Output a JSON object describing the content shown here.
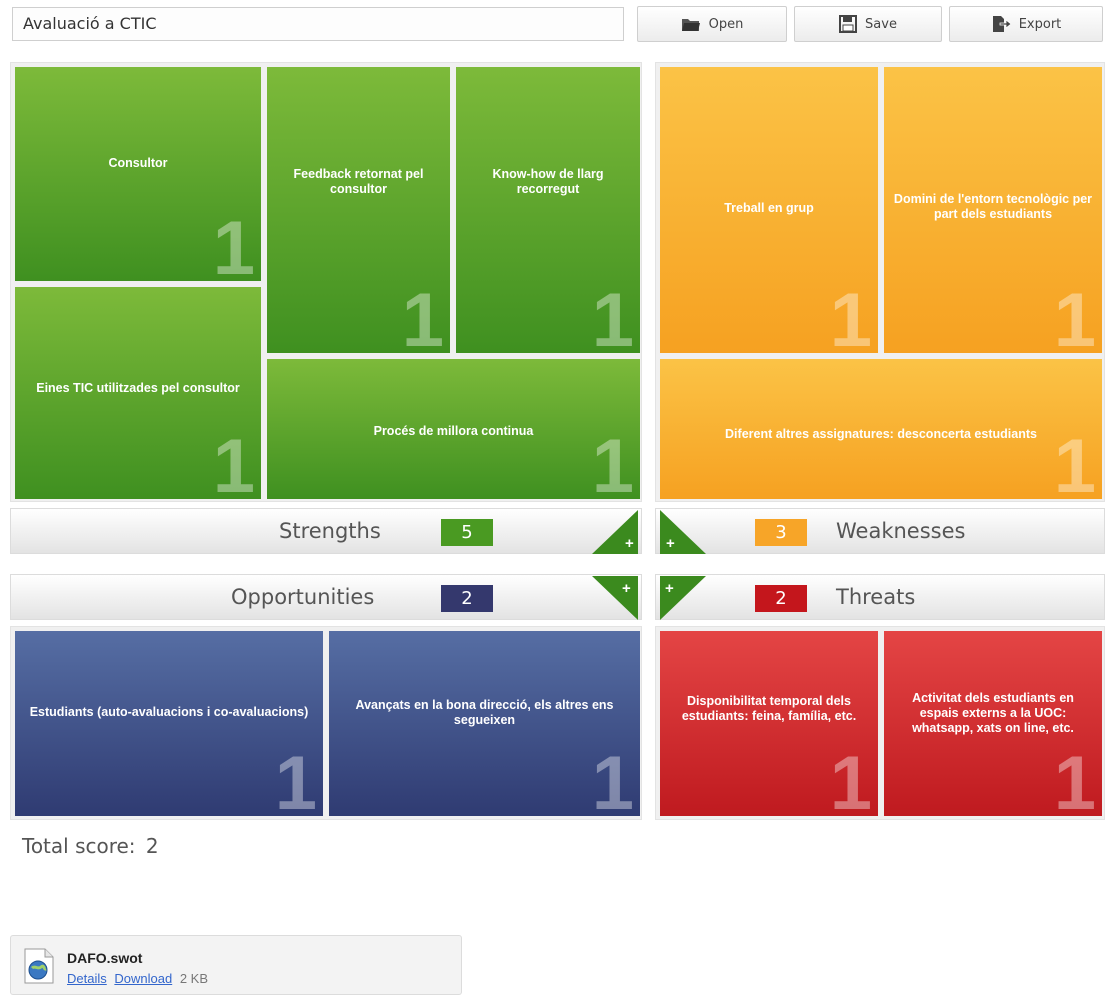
{
  "toolbar": {
    "title": "Avaluació a CTIC",
    "open_label": "Open",
    "save_label": "Save",
    "export_label": "Export"
  },
  "strengths": {
    "name": "Strengths",
    "count": "5",
    "color": "#4a9a22",
    "add_label": "+",
    "items": [
      {
        "label": "Consultor",
        "score": "1"
      },
      {
        "label": "Feedback retornat pel consultor",
        "score": "1"
      },
      {
        "label": "Know-how de llarg recorregut",
        "score": "1"
      },
      {
        "label": "Eines  TIC utilitzades pel consultor",
        "score": "1"
      },
      {
        "label": "Procés de millora continua",
        "score": "1"
      }
    ]
  },
  "weaknesses": {
    "name": "Weaknesses",
    "count": "3",
    "color": "#f7a528",
    "add_label": "+",
    "items": [
      {
        "label": "Treball en grup",
        "score": "1"
      },
      {
        "label": "Domini de l'entorn tecnològic per part dels estudiants",
        "score": "1"
      },
      {
        "label": "Diferent altres assignatures: desconcerta estudiants",
        "score": "1"
      }
    ]
  },
  "opportunities": {
    "name": "Opportunities",
    "count": "2",
    "color": "#34386d",
    "add_label": "+",
    "items": [
      {
        "label": "Estudiants  (auto-avaluacions i co-avaluacions)",
        "score": "1"
      },
      {
        "label": "Avançats en la bona direcció, els altres ens segueixen",
        "score": "1"
      }
    ]
  },
  "threats": {
    "name": "Threats",
    "count": "2",
    "color": "#c4161c",
    "add_label": "+",
    "items": [
      {
        "label": "Disponibilitat temporal dels estudiants: feina, família, etc.",
        "score": "1"
      },
      {
        "label": "Activitat dels estudiants en espais externs a la UOC: whatsapp, xats on line, etc.",
        "score": "1"
      }
    ]
  },
  "total": {
    "label": "Total score:",
    "value": "2"
  },
  "attachment": {
    "filename": "DAFO.swot",
    "details_link": "Details",
    "download_link": "Download",
    "size": "2 KB",
    "icon": "globe-file-icon"
  }
}
